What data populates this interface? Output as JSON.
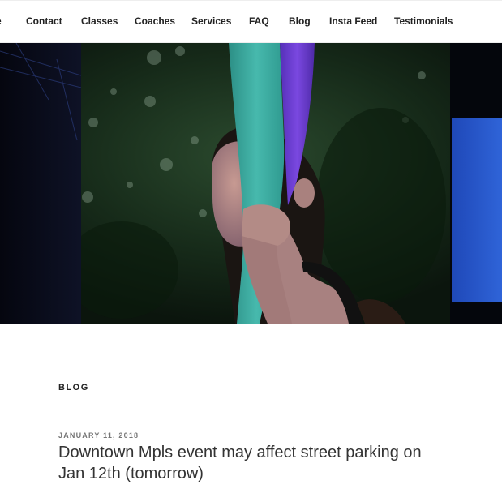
{
  "nav": {
    "items": [
      {
        "label": "e"
      },
      {
        "label": "Contact"
      },
      {
        "label": "Classes"
      },
      {
        "label": "Coaches"
      },
      {
        "label": "Services"
      },
      {
        "label": "FAQ"
      },
      {
        "label": "Blog"
      },
      {
        "label": "Insta Feed"
      },
      {
        "label": "Testimonials"
      }
    ]
  },
  "hero": {
    "image": "aerial-silks-performer-photo",
    "colors": {
      "foliage": "#1d3a22",
      "silk_teal": "#3fb3a8",
      "silk_purple": "#6a3fd0",
      "stage_blue": "#2a5fd6",
      "skin": "#b08a86"
    }
  },
  "blog": {
    "section_label": "BLOG",
    "posts": [
      {
        "date": "JANUARY 11, 2018",
        "title": "Downtown Mpls event may affect street parking on Jan 12th (tomorrow)"
      }
    ]
  }
}
